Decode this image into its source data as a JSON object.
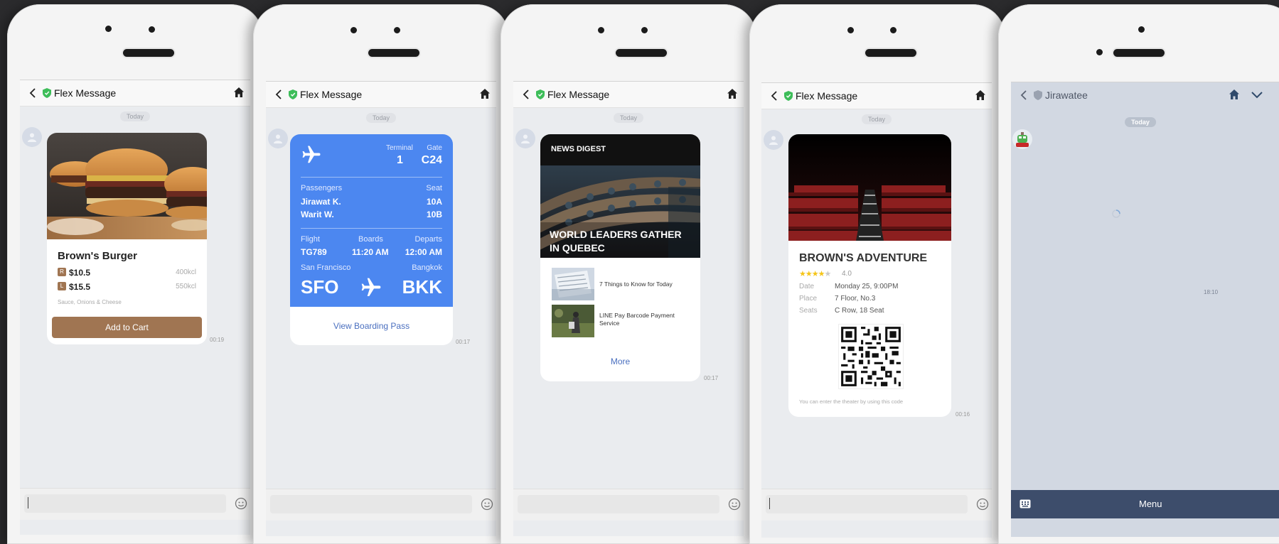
{
  "today_label": "Today",
  "header_title": "Flex Message",
  "phones": {
    "burger": {
      "product_name": "Brown's Burger",
      "sizes": [
        {
          "badge": "R",
          "price": "$10.5",
          "kcal": "400kcl"
        },
        {
          "badge": "L",
          "price": "$15.5",
          "kcal": "550kcl"
        }
      ],
      "ingredients": "Sauce, Onions & Cheese",
      "add_button": "Add to Cart",
      "time": "00:19"
    },
    "flight": {
      "terminal_label": "Terminal",
      "terminal_value": "1",
      "gate_label": "Gate",
      "gate_value": "C24",
      "passengers_label": "Passengers",
      "seat_label": "Seat",
      "passengers": [
        {
          "name": "Jirawat K.",
          "seat": "10A"
        },
        {
          "name": "Warit W.",
          "seat": "10B"
        }
      ],
      "flight_label": "Flight",
      "flight_value": "TG789",
      "boards_label": "Boards",
      "boards_value": "11:20 AM",
      "departs_label": "Departs",
      "departs_value": "12:00 AM",
      "origin_city": "San Francisco",
      "origin_code": "SFO",
      "dest_city": "Bangkok",
      "dest_code": "BKK",
      "view_button": "View Boarding Pass",
      "time": "00:17",
      "card_color": "#4c87f0"
    },
    "news": {
      "digest_label": "NEWS DIGEST",
      "headline_line1": "WORLD LEADERS GATHER",
      "headline_line2": "IN QUEBEC",
      "articles": [
        {
          "title": "7 Things to Know for Today"
        },
        {
          "title_line1": "LINE Pay Barcode Payment",
          "title_line2": "Service"
        }
      ],
      "more_button": "More",
      "time": "00:17"
    },
    "movie": {
      "title": "BROWN'S ADVENTURE",
      "rating": "4.0",
      "rating_stars": 4,
      "rows": [
        {
          "label": "Date",
          "value": "Monday 25, 9:00PM"
        },
        {
          "label": "Place",
          "value": "7 Floor, No.3"
        },
        {
          "label": "Seats",
          "value": "C Row, 18 Seat"
        }
      ],
      "footer": "You can enter the theater by using this code",
      "time": "00:16"
    },
    "chat": {
      "title": "Jirawatee",
      "time": "18:10",
      "menu_label": "Menu"
    }
  },
  "colors": {
    "accent_brown": "#a07552",
    "flight_blue": "#4c87f0",
    "link_blue": "#4a6fbf",
    "shield_green": "#3dbd59",
    "menu_bar": "#3d4d6b"
  }
}
